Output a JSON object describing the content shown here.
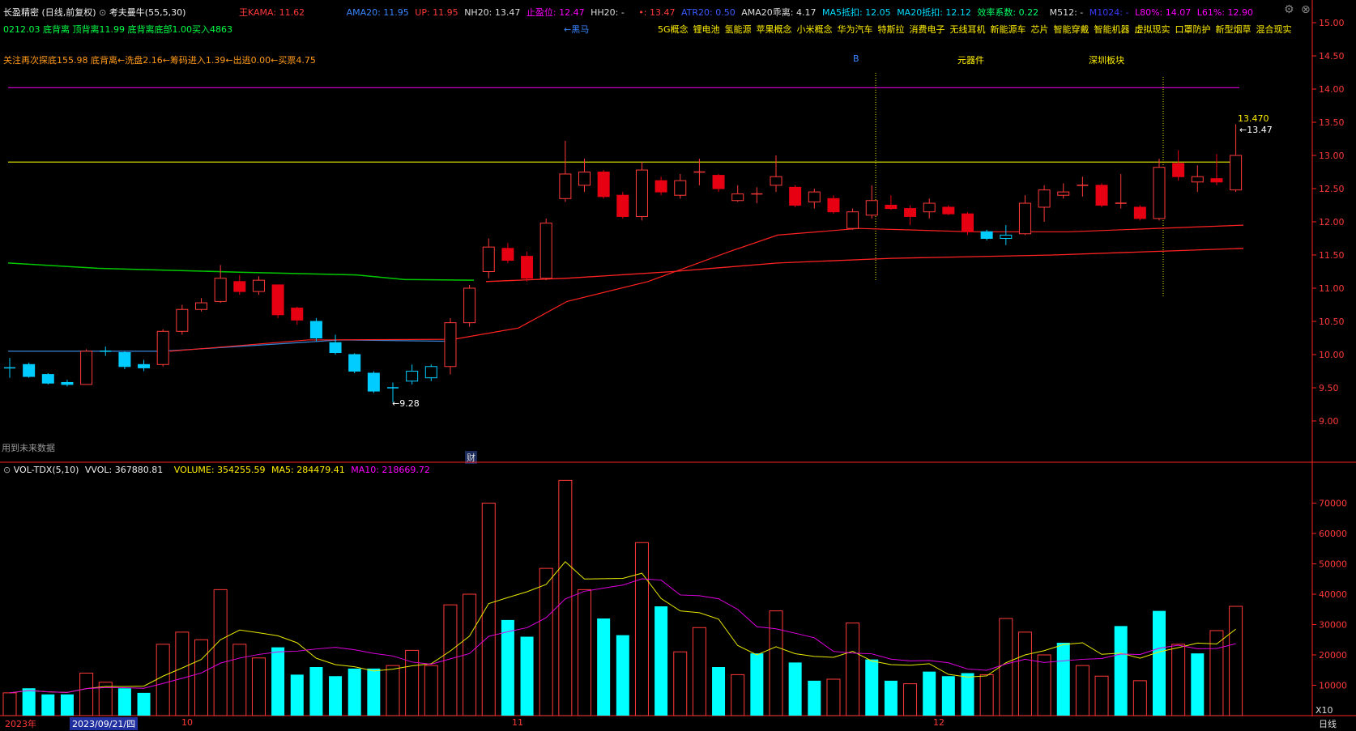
{
  "header": {
    "stock": "长盈精密",
    "period": "(日线,前复权)",
    "indicator": "考夫曼牛(55,5,30)",
    "kama": "王KAMA: 11.62",
    "ama20": "AMA20: 11.95",
    "up": "UP: 11.95",
    "nh20": "NH20: 13.47",
    "stop": "止盈位: 12.47",
    "hh20": "HH20: -",
    "dot_val": "•: 13.47",
    "atr": "ATR20: 0.50",
    "ama_diff": "AMA20乖离: 4.17",
    "ma5": "MA5抵扣: 12.05",
    "ma20": "MA20抵扣: 12.12",
    "eff": "效率系数: 0.22",
    "m512": "M512: -",
    "m1024": "M1024: -",
    "l80": "L80%: 14.07",
    "l61": "L61%: 12.90"
  },
  "line2": {
    "green": "0212.03  底背离  顶背离11.99  底背离底部1.00买入4863",
    "heima": "←黑马"
  },
  "concepts": [
    "5G概念",
    "锂电池",
    "氢能源",
    "苹果概念",
    "小米概念",
    "华为汽车",
    "特斯拉",
    "消费电子",
    "无线耳机",
    "新能源车",
    "芯片",
    "智能穿戴",
    "智能机器",
    "虚拟现实",
    "口罩防护",
    "新型烟草",
    "混合现实"
  ],
  "line3": {
    "orange": "关注再次探底155.98  底背离←洗盘2.16←筹码进入1.39←出逃0.00←买票4.75",
    "b": "B",
    "yuanqijian": "元器件",
    "shenzhen": "深圳板块"
  },
  "notes": {
    "future": "用到未来数据",
    "cai": "财"
  },
  "annotations": {
    "high": "13.470",
    "high_arrow": "←13.47",
    "low": "←9.28"
  },
  "volume_header": {
    "name": "VOL-TDX(5,10)",
    "vvol": "VVOL: 367880.81",
    "volume": "VOLUME: 354255.59",
    "ma5": "MA5: 284479.41",
    "ma10": "MA10: 218669.72"
  },
  "bottom": {
    "year": "2023年",
    "date": "2023/09/21/四",
    "m10": "10",
    "m11": "11",
    "m12": "12",
    "x10": "X10",
    "period": "日线"
  },
  "controls": {
    "settings": "⚙",
    "close": "⊗"
  },
  "colors": {
    "up": "#ff3a3a",
    "down_fill": "#e60012",
    "cyan": "#00ddff",
    "green_ma": "#00d000",
    "blue_ma": "#3a86d8",
    "yellow": "#e8e800",
    "magenta": "#d000d0"
  },
  "chart_data": [
    {
      "type": "candlestick",
      "ylim": [
        8.5,
        15.0
      ],
      "yticks": [
        "15.00",
        "14.50",
        "14.00",
        "13.50",
        "13.00",
        "12.50",
        "12.00",
        "11.50",
        "11.00",
        "10.50",
        "10.00",
        "9.50",
        "9.00"
      ],
      "candles": [
        {
          "o": 9.8,
          "h": 9.95,
          "l": 9.65,
          "c": 9.8,
          "t": "flat"
        },
        {
          "o": 9.85,
          "h": 9.88,
          "l": 9.65,
          "c": 9.67,
          "t": "down"
        },
        {
          "o": 9.7,
          "h": 9.72,
          "l": 9.55,
          "c": 9.57,
          "t": "down"
        },
        {
          "o": 9.58,
          "h": 9.62,
          "l": 9.52,
          "c": 9.55,
          "t": "down"
        },
        {
          "o": 9.55,
          "h": 10.08,
          "l": 9.55,
          "c": 10.05,
          "t": "up"
        },
        {
          "o": 10.05,
          "h": 10.12,
          "l": 9.98,
          "c": 10.05,
          "t": "flat"
        },
        {
          "o": 10.03,
          "h": 10.05,
          "l": 9.78,
          "c": 9.82,
          "t": "down"
        },
        {
          "o": 9.85,
          "h": 9.92,
          "l": 9.75,
          "c": 9.8,
          "t": "down"
        },
        {
          "o": 9.85,
          "h": 10.38,
          "l": 9.82,
          "c": 10.35,
          "t": "up"
        },
        {
          "o": 10.35,
          "h": 10.75,
          "l": 10.3,
          "c": 10.68,
          "t": "up"
        },
        {
          "o": 10.68,
          "h": 10.85,
          "l": 10.65,
          "c": 10.78,
          "t": "up"
        },
        {
          "o": 10.8,
          "h": 11.35,
          "l": 10.78,
          "c": 11.15,
          "t": "up"
        },
        {
          "o": 11.1,
          "h": 11.2,
          "l": 10.9,
          "c": 10.95,
          "t": "downred"
        },
        {
          "o": 10.95,
          "h": 11.18,
          "l": 10.9,
          "c": 11.12,
          "t": "up"
        },
        {
          "o": 11.05,
          "h": 11.05,
          "l": 10.55,
          "c": 10.6,
          "t": "downred"
        },
        {
          "o": 10.7,
          "h": 10.72,
          "l": 10.45,
          "c": 10.52,
          "t": "downred"
        },
        {
          "o": 10.5,
          "h": 10.55,
          "l": 10.2,
          "c": 10.25,
          "t": "down"
        },
        {
          "o": 10.18,
          "h": 10.3,
          "l": 10.0,
          "c": 10.03,
          "t": "down"
        },
        {
          "o": 10.0,
          "h": 10.02,
          "l": 9.72,
          "c": 9.75,
          "t": "down"
        },
        {
          "o": 9.72,
          "h": 9.75,
          "l": 9.42,
          "c": 9.45,
          "t": "down"
        },
        {
          "o": 9.5,
          "h": 9.58,
          "l": 9.28,
          "c": 9.5,
          "t": "flat"
        },
        {
          "o": 9.6,
          "h": 9.85,
          "l": 9.55,
          "c": 9.75,
          "t": "upc"
        },
        {
          "o": 9.65,
          "h": 9.85,
          "l": 9.6,
          "c": 9.82,
          "t": "upc"
        },
        {
          "o": 9.82,
          "h": 10.55,
          "l": 9.7,
          "c": 10.48,
          "t": "up"
        },
        {
          "o": 10.48,
          "h": 11.05,
          "l": 10.42,
          "c": 11.0,
          "t": "up"
        },
        {
          "o": 11.25,
          "h": 11.75,
          "l": 11.15,
          "c": 11.62,
          "t": "up"
        },
        {
          "o": 11.6,
          "h": 11.68,
          "l": 11.38,
          "c": 11.42,
          "t": "downred"
        },
        {
          "o": 11.48,
          "h": 11.55,
          "l": 11.1,
          "c": 11.15,
          "t": "downred"
        },
        {
          "o": 11.15,
          "h": 12.05,
          "l": 11.12,
          "c": 11.98,
          "t": "up"
        },
        {
          "o": 12.35,
          "h": 13.22,
          "l": 12.3,
          "c": 12.72,
          "t": "up"
        },
        {
          "o": 12.55,
          "h": 12.95,
          "l": 12.45,
          "c": 12.75,
          "t": "up"
        },
        {
          "o": 12.75,
          "h": 12.78,
          "l": 12.35,
          "c": 12.38,
          "t": "downred"
        },
        {
          "o": 12.4,
          "h": 12.45,
          "l": 12.05,
          "c": 12.08,
          "t": "downred"
        },
        {
          "o": 12.08,
          "h": 12.9,
          "l": 12.02,
          "c": 12.78,
          "t": "up"
        },
        {
          "o": 12.62,
          "h": 12.68,
          "l": 12.4,
          "c": 12.45,
          "t": "downred"
        },
        {
          "o": 12.4,
          "h": 12.72,
          "l": 12.35,
          "c": 12.62,
          "t": "up"
        },
        {
          "o": 12.75,
          "h": 12.95,
          "l": 12.55,
          "c": 12.75,
          "t": "flat"
        },
        {
          "o": 12.7,
          "h": 12.72,
          "l": 12.45,
          "c": 12.5,
          "t": "downred"
        },
        {
          "o": 12.32,
          "h": 12.55,
          "l": 12.3,
          "c": 12.42,
          "t": "up"
        },
        {
          "o": 12.4,
          "h": 12.52,
          "l": 12.28,
          "c": 12.42,
          "t": "flat"
        },
        {
          "o": 12.55,
          "h": 13.0,
          "l": 12.45,
          "c": 12.68,
          "t": "up"
        },
        {
          "o": 12.52,
          "h": 12.55,
          "l": 12.22,
          "c": 12.25,
          "t": "downred"
        },
        {
          "o": 12.45,
          "h": 12.5,
          "l": 12.2,
          "c": 12.3,
          "t": "up"
        },
        {
          "o": 12.35,
          "h": 12.4,
          "l": 12.12,
          "c": 12.15,
          "t": "downred"
        },
        {
          "o": 11.9,
          "h": 12.2,
          "l": 11.88,
          "c": 12.15,
          "t": "up"
        },
        {
          "o": 12.1,
          "h": 12.55,
          "l": 12.05,
          "c": 12.32,
          "t": "up"
        },
        {
          "o": 12.25,
          "h": 12.4,
          "l": 12.18,
          "c": 12.2,
          "t": "downred"
        },
        {
          "o": 12.2,
          "h": 12.25,
          "l": 11.95,
          "c": 12.08,
          "t": "downred"
        },
        {
          "o": 12.15,
          "h": 12.35,
          "l": 12.05,
          "c": 12.28,
          "t": "up"
        },
        {
          "o": 12.22,
          "h": 12.25,
          "l": 12.1,
          "c": 12.12,
          "t": "downred"
        },
        {
          "o": 12.12,
          "h": 12.15,
          "l": 11.8,
          "c": 11.85,
          "t": "downred"
        },
        {
          "o": 11.85,
          "h": 11.88,
          "l": 11.72,
          "c": 11.75,
          "t": "down"
        },
        {
          "o": 11.75,
          "h": 11.95,
          "l": 11.65,
          "c": 11.8,
          "t": "upc"
        },
        {
          "o": 11.82,
          "h": 12.4,
          "l": 11.8,
          "c": 12.28,
          "t": "up"
        },
        {
          "o": 12.22,
          "h": 12.55,
          "l": 12.0,
          "c": 12.48,
          "t": "up"
        },
        {
          "o": 12.4,
          "h": 12.58,
          "l": 12.35,
          "c": 12.45,
          "t": "up"
        },
        {
          "o": 12.55,
          "h": 12.68,
          "l": 12.38,
          "c": 12.45,
          "t": "flat"
        },
        {
          "o": 12.55,
          "h": 12.58,
          "l": 12.22,
          "c": 12.25,
          "t": "downred"
        },
        {
          "o": 12.28,
          "h": 12.72,
          "l": 12.2,
          "c": 12.28,
          "t": "flat"
        },
        {
          "o": 12.22,
          "h": 12.25,
          "l": 12.02,
          "c": 12.05,
          "t": "downred"
        },
        {
          "o": 12.05,
          "h": 12.95,
          "l": 12.02,
          "c": 12.82,
          "t": "up"
        },
        {
          "o": 12.88,
          "h": 13.08,
          "l": 12.62,
          "c": 12.68,
          "t": "downred"
        },
        {
          "o": 12.6,
          "h": 12.85,
          "l": 12.45,
          "c": 12.68,
          "t": "up"
        },
        {
          "o": 12.65,
          "h": 13.02,
          "l": 12.55,
          "c": 12.6,
          "t": "downred"
        },
        {
          "o": 12.48,
          "h": 13.47,
          "l": 12.45,
          "c": 13.0,
          "t": "up"
        }
      ]
    },
    {
      "type": "bar",
      "ylim": [
        0,
        80000
      ],
      "yticks": [
        "70000",
        "60000",
        "50000",
        "40000",
        "30000",
        "20000",
        "10000"
      ],
      "values": [
        7500,
        9000,
        7000,
        7000,
        14000,
        11000,
        9000,
        7500,
        23500,
        27500,
        25000,
        41500,
        23500,
        19000,
        22500,
        13500,
        16000,
        13000,
        15500,
        15500,
        16500,
        21500,
        16500,
        36500,
        40000,
        70000,
        31500,
        26000,
        48500,
        77500,
        41500,
        32000,
        26500,
        57000,
        36000,
        21000,
        29000,
        16000,
        13500,
        20500,
        34500,
        17500,
        11500,
        12000,
        30500,
        18500,
        11500,
        10500,
        14500,
        13000,
        14000,
        13500,
        32000,
        27500,
        20000,
        24000,
        16500,
        13000,
        29500,
        11500,
        34500,
        23500,
        20500,
        28000,
        36000
      ],
      "colors": [
        "r",
        "c",
        "c",
        "c",
        "r",
        "r",
        "c",
        "c",
        "r",
        "r",
        "r",
        "r",
        "r",
        "r",
        "c",
        "c",
        "c",
        "c",
        "c",
        "c",
        "r",
        "r",
        "r",
        "r",
        "r",
        "r",
        "c",
        "c",
        "r",
        "r",
        "r",
        "c",
        "c",
        "r",
        "c",
        "r",
        "r",
        "c",
        "r",
        "c",
        "r",
        "c",
        "c",
        "r",
        "r",
        "c",
        "c",
        "r",
        "c",
        "c",
        "c",
        "r",
        "r",
        "r",
        "r",
        "c",
        "r",
        "r",
        "c",
        "r",
        "c",
        "r",
        "c",
        "r",
        "r"
      ]
    }
  ]
}
